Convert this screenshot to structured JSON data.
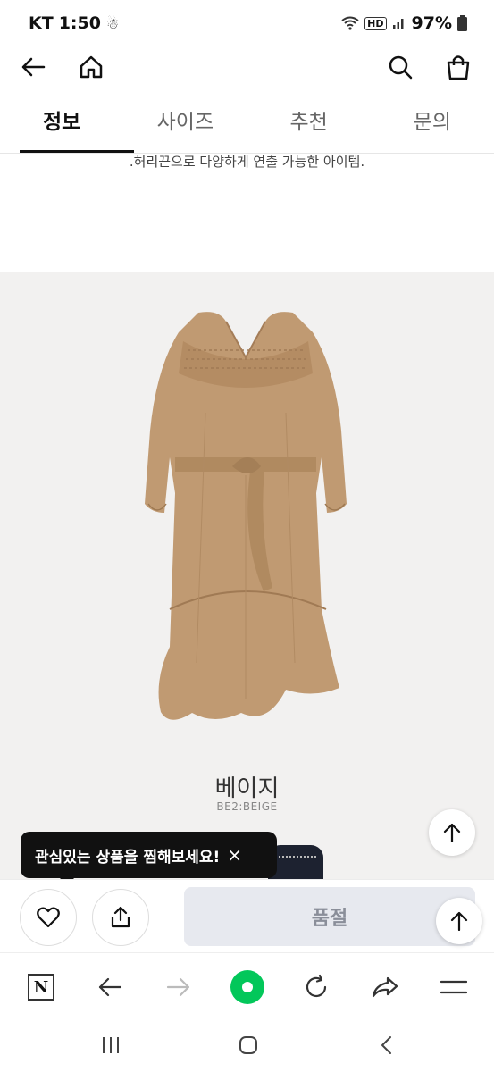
{
  "status_bar": {
    "carrier": "KT",
    "time": "1:50",
    "hd": "HD",
    "battery": "97%"
  },
  "top_bar": {
    "back_icon": "arrow-left-icon",
    "home_icon": "home-icon",
    "search_icon": "search-icon",
    "bag_icon": "shopping-bag-icon"
  },
  "tabs": [
    {
      "label": "정보",
      "active": true
    },
    {
      "label": "사이즈",
      "active": false
    },
    {
      "label": "추천",
      "active": false
    },
    {
      "label": "문의",
      "active": false
    }
  ],
  "description": ".허리끈으로 다양하게 연출 가능한 아이템.",
  "product": {
    "color_name": "베이지",
    "color_code": "BE2:BEIGE",
    "dress_color": "#c09a72"
  },
  "tooltip": {
    "text": "관심있는 상품을 찜해보세요!",
    "close": "×"
  },
  "action_bar": {
    "wish_icon": "heart-icon",
    "share_icon": "share-icon",
    "soldout_label": "품절"
  },
  "browser_bar": {
    "n_label": "N"
  },
  "colors": {
    "accent_green": "#03c75a",
    "soldout_bg": "#e7e9ef"
  }
}
